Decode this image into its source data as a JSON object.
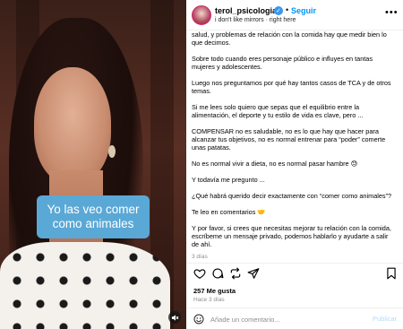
{
  "media": {
    "caption_overlay": "Yo las veo comer como animales",
    "mute_icon": "speaker-muted-icon"
  },
  "header": {
    "username": "terol_psicologia",
    "verified_icon": "verified-badge-icon",
    "separator": "•",
    "follow_label": "Seguir",
    "audio_info": "i don't like mirrors · right here",
    "more_icon": "more-options-icon"
  },
  "caption": {
    "paragraphs": [
      "salud, y problemas de relación con la comida hay que medir bien lo que decimos.",
      "Sobre todo cuando eres personaje público e influyes en tantas mujeres y adolescentes.",
      "Luego nos preguntamos por qué hay tantos casos de TCA y de otros temas.",
      "Si me lees solo quiero que sepas que el equilibrio entre la alimentación, el deporte y tu estilo de vida es clave, pero ...",
      "COMPENSAR no es saludable, no es lo que hay que hacer para alcanzar tus objetivos, no es normal entrenar para “poder” comerte unas patatas.",
      "No es normal vivir a dieta, no es normal pasar hambre 😓",
      "Y todavía me pregunto ...",
      "¿Qué habrá querido decir exactamente con “comer como animales”?",
      "Te leo en comentarios 🤝",
      "Y por favor, si crees que necesitas mejorar tu relación con la comida, escríbeme un mensaje privado, podemos hablarlo y ayudarte a salir de ahí."
    ],
    "age": "3 días"
  },
  "actions": {
    "like_icon": "heart-icon",
    "comment_icon": "comment-icon",
    "share_icon": "repost-icon",
    "send_icon": "paper-plane-icon",
    "save_icon": "bookmark-icon"
  },
  "stats": {
    "likes": "257 Me gusta",
    "time": "Hace 3 días"
  },
  "comment_box": {
    "emoji_icon": "emoji-icon",
    "placeholder": "Añade un comentario...",
    "value": "",
    "post_label": "Publicar"
  },
  "colors": {
    "accent": "#0095f6",
    "caption_overlay_bg": "#5aa8d6",
    "post_disabled": "#b3dbff"
  }
}
